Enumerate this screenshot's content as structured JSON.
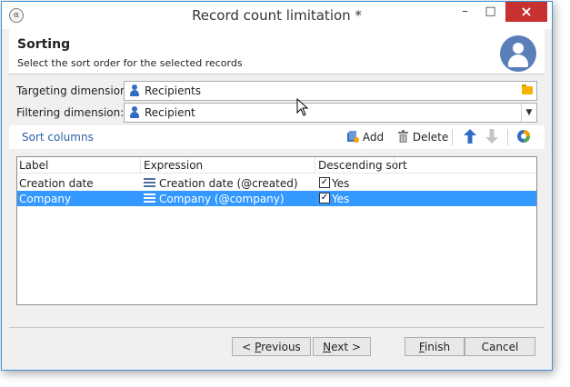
{
  "window": {
    "title": "Record count limitation *"
  },
  "header": {
    "title": "Sorting",
    "subtitle": "Select the sort order for the selected records"
  },
  "targeting": {
    "label": "Targeting dimension:",
    "value": "Recipients"
  },
  "filtering": {
    "label": "Filtering dimension:",
    "value": "Recipient"
  },
  "toolbar": {
    "section_link": "Sort columns",
    "add_label": "Add",
    "delete_label": "Delete"
  },
  "grid": {
    "columns": [
      "Label",
      "Expression",
      "Descending sort"
    ],
    "rows": [
      {
        "label": "Creation date",
        "expression": "Creation date (@created)",
        "descending": "Yes",
        "checked": true,
        "selected": false
      },
      {
        "label": "Company",
        "expression": "Company (@company)",
        "descending": "Yes",
        "checked": true,
        "selected": true
      }
    ]
  },
  "buttons": {
    "previous": {
      "prefix": "< ",
      "mnemonic": "P",
      "rest": "revious"
    },
    "next": {
      "mnemonic": "N",
      "rest": "ext >"
    },
    "finish": {
      "mnemonic": "F",
      "rest": "inish"
    },
    "cancel": "Cancel"
  },
  "colors": {
    "selection": "#3399ff",
    "link": "#2a5da8",
    "close_button": "#c7312f",
    "avatar": "#5a7fb8"
  }
}
